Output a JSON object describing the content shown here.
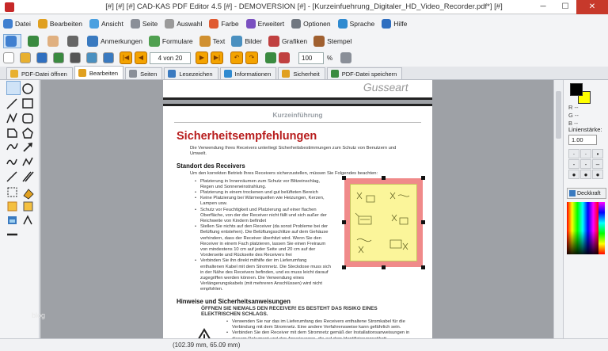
{
  "window": {
    "title": "[#] [#] [#] CAD-KAS PDF Editor 4.5 [#] - DEMOVERSION [#] - [Kurzeinfuehrung_Digitaler_HD_Video_Recorder.pdf*] [#]",
    "minimize": "─",
    "maximize": "☐",
    "close": "✕"
  },
  "menu": {
    "items": [
      {
        "label": "Datei",
        "icon": "file-icon",
        "color": "#3f7fd0"
      },
      {
        "label": "Bearbeiten",
        "icon": "pencil-icon",
        "color": "#e0a020"
      },
      {
        "label": "Ansicht",
        "icon": "view-icon",
        "color": "#4aa0e0"
      },
      {
        "label": "Seite",
        "icon": "page-icon",
        "color": "#8a8f98"
      },
      {
        "label": "Auswahl",
        "icon": "lasso-icon",
        "color": "#9a9a9a"
      },
      {
        "label": "Farbe",
        "icon": "palette-icon",
        "color": "#e05a30"
      },
      {
        "label": "Erweitert",
        "icon": "magic-wand-icon",
        "color": "#7a50c0"
      },
      {
        "label": "Optionen",
        "icon": "gear-icon",
        "color": "#707780"
      },
      {
        "label": "Sprache",
        "icon": "globe-icon",
        "color": "#2f8ad0"
      },
      {
        "label": "Hilfe",
        "icon": "help-icon",
        "color": "#2f6fc0"
      }
    ]
  },
  "toolbar1": {
    "items": [
      {
        "label": "",
        "icon": "select-arrow-icon",
        "color": "#3f7fd0",
        "selected": true
      },
      {
        "label": "",
        "icon": "text-select-icon",
        "color": "#3a8a40"
      },
      {
        "label": "",
        "icon": "hand-icon",
        "color": "#e0b080"
      },
      {
        "label": "",
        "icon": "eyedropper-icon",
        "color": "#666"
      },
      {
        "label": "Anmerkungen",
        "icon": "annotation-icon",
        "color": "#3a7ac0"
      },
      {
        "label": "Formulare",
        "icon": "form-icon",
        "color": "#50a050"
      },
      {
        "label": "Text",
        "icon": "text-icon",
        "color": "#d09030"
      },
      {
        "label": "Bilder",
        "icon": "image-icon",
        "color": "#4a90c0"
      },
      {
        "label": "Grafiken",
        "icon": "graphics-icon",
        "color": "#c04040"
      },
      {
        "label": "Stempel",
        "icon": "stamp-icon",
        "color": "#a06030"
      }
    ]
  },
  "toolbar2": {
    "icons": [
      {
        "name": "new-icon",
        "color": "#ffffff"
      },
      {
        "name": "open-icon",
        "color": "#e8b030"
      },
      {
        "name": "save-icon",
        "color": "#2f6fc0"
      },
      {
        "name": "save-as-icon",
        "color": "#3a8a40"
      },
      {
        "name": "print-icon",
        "color": "#555"
      },
      {
        "name": "scan-icon",
        "color": "#4a90c0"
      },
      {
        "name": "rotate-icon",
        "color": "#3a7ac0"
      }
    ],
    "page_indicator": "4 von 20",
    "zoom_value": "100",
    "zoom_unit": "%"
  },
  "tabs": [
    {
      "label": "PDF-Datei öffnen",
      "icon": "open-folder-icon",
      "color": "#e8b030",
      "active": false
    },
    {
      "label": "Bearbeiten",
      "icon": "pencil-icon",
      "color": "#e0a020",
      "active": true
    },
    {
      "label": "Seiten",
      "icon": "page-icon",
      "color": "#8a8f98",
      "active": false
    },
    {
      "label": "Lesezeichen",
      "icon": "bookmark-icon",
      "color": "#3a7ac0",
      "active": false
    },
    {
      "label": "Informationen",
      "icon": "info-icon",
      "color": "#2f8ad0",
      "active": false
    },
    {
      "label": "Sicherheit",
      "icon": "lock-icon",
      "color": "#e0a020",
      "active": false
    },
    {
      "label": "PDF-Datei speichern",
      "icon": "save-icon",
      "color": "#3a8a40",
      "active": false
    }
  ],
  "document": {
    "top_partial": "Gusseart",
    "header": "Kurzeinführung",
    "title": "Sicherheitsempfehlungen",
    "intro": "Die Verwendung Ihres Receivers unterliegt Sicherheitsbestimmungen zum Schutz von Benutzern und Umwelt.",
    "section1": "Standort des Receivers",
    "section1_text": "Um den korrekten Betrieb Ihres Receivers sicherzustellen, müssen Sie Folgendes beachten:",
    "bullets": [
      "Platzierung in Innenräumen zum Schutz vor Blitzeinschlag, Regen und Sonneneinstrahlung.",
      "Platzierung in einem trockenen und gut belüfteten Bereich",
      "Keine Platzierung bei Wärmequellen wie Heizungen, Kerzen, Lampen usw.",
      "Schutz vor Feuchtigkeit und Platzierung auf einer flachen Oberfläche, von der der Receiver nicht fällt und sich außer der Reichweite von Kindern befindet",
      "Stellen Sie nichts auf den Receiver (da sonst Probleme bei der Belüftung entstehen). Die Belüftungsschlitze auf dem Gehäuse verhindern, dass der Receiver überhitzt wird. Wenn Sie den Receiver in einem Fach platzieren, lassen Sie einen Freiraum von mindestens 10 cm auf jeder Seite und 20 cm auf der Vorderseite und Rückseite des Receivers frei",
      "Verbinden Sie ihn direkt mithilfe der im Lieferumfang enthaltenen Kabel mit dem Stromnetz. Die Steckdose muss sich in der Nähe des Receivers befinden, und es muss leicht darauf zugegriffen werden können. Die Verwendung eines Verlängerungskabels (mit mehreren Anschlüssen) wird nicht empfohlen."
    ],
    "section2": "Hinweise und Sicherheitsanweisungen",
    "warning": "ÖFFNEN SIE NIEMALS DEN RECEIVER! ES BESTEHT DAS RISIKO EINES ELEKTRISCHEN SCHLAGS.",
    "warn_bullets": [
      "Verwenden Sie nur das im Lieferumfang des Receivers enthaltene Stromkabel für die Verbindung mit dem Stromnetz. Eine andere Verfahrensweise kann gefährlich sein.",
      "Verbinden Sie den Receiver mit dem Stromnetz gemäß der Installationsanweisungen in diesem Dokument und den Anweisungen, die auf dem Identifizierungsetikett angegeben"
    ],
    "sticker_fill": "#fbf59a",
    "sticker_border": "#f08a8a"
  },
  "right_panel": {
    "foreground_color": "#000000",
    "background_color": "#ffff00",
    "channel_labels": [
      "R --",
      "G --",
      "B --"
    ],
    "line_width_label": "Linienstärke:",
    "line_width_value": "1.00",
    "opacity_button": "Deckkraft"
  },
  "statusbar": {
    "coords": "(102.39 mm, 65.09 mm)"
  },
  "watermark": "blog"
}
